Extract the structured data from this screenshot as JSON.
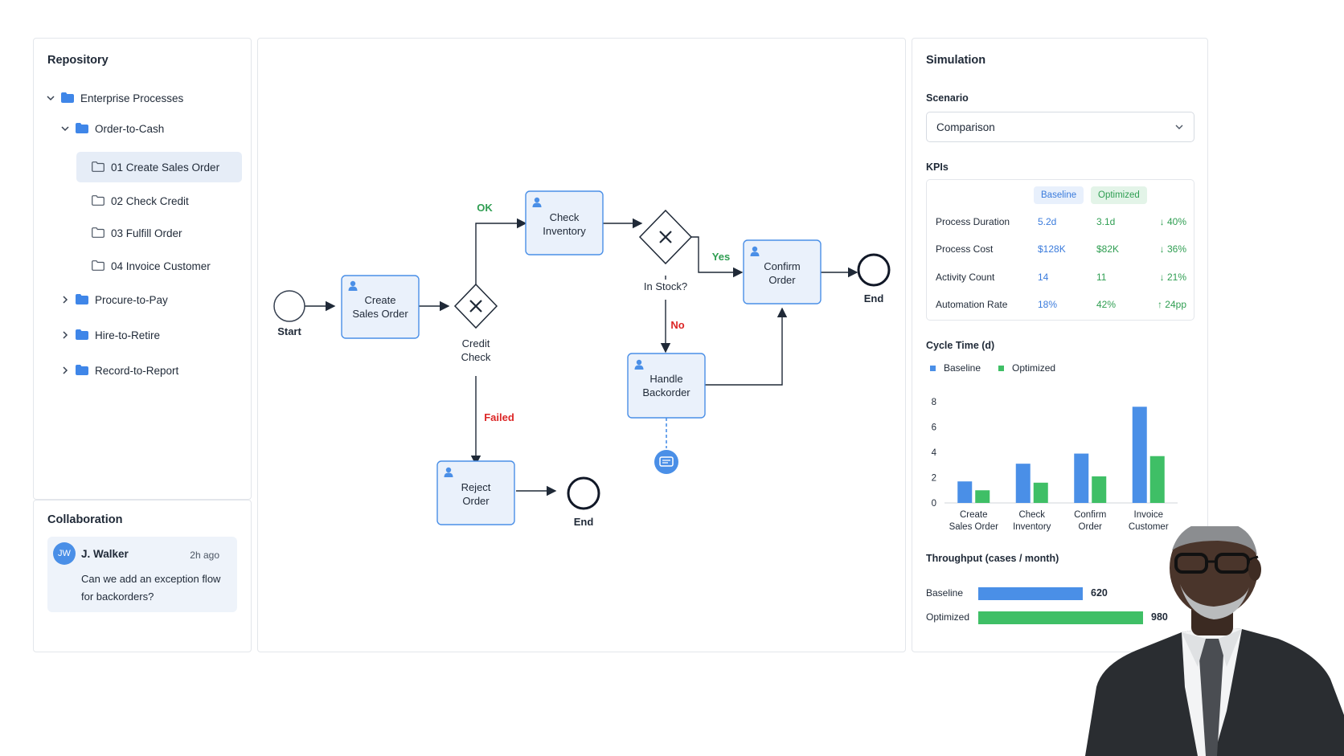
{
  "repository": {
    "title": "Repository",
    "tree": [
      {
        "label": "Enterprise Processes",
        "state": "expanded"
      },
      {
        "label": "Order-to-Cash",
        "state": "expanded"
      },
      {
        "label": "01 Create Sales Order",
        "state": "selected"
      },
      {
        "label": "02 Check Credit"
      },
      {
        "label": "03 Fulfill Order"
      },
      {
        "label": "04 Invoice Customer"
      },
      {
        "label": "Procure-to-Pay",
        "state": "collapsed"
      },
      {
        "label": "Hire-to-Retire",
        "state": "collapsed"
      },
      {
        "label": "Record-to-Report",
        "state": "collapsed"
      }
    ]
  },
  "collaboration": {
    "title": "Collaboration",
    "comment": {
      "initials": "JW",
      "author": "J. Walker",
      "time": "2h ago",
      "text": "Can we add an exception flow for backorders?"
    }
  },
  "diagram": {
    "events": {
      "start": "Start",
      "end_main": "End",
      "end_reject": "End"
    },
    "tasks": {
      "create_sales_order": [
        "Create",
        "Sales Order"
      ],
      "check_inventory": [
        "Check",
        "Inventory"
      ],
      "confirm_order": [
        "Confirm",
        "Order"
      ],
      "handle_backorder": [
        "Handle",
        "Backorder"
      ],
      "reject_order": [
        "Reject",
        "Order"
      ]
    },
    "gateways": {
      "credit_check": [
        "Credit",
        "Check"
      ],
      "in_stock": "In Stock?"
    },
    "flows": {
      "ok": "OK",
      "failed": "Failed",
      "yes": "Yes",
      "no": "No"
    },
    "colors": {
      "ok": "#2f9e52",
      "failed": "#dc2626",
      "task_fill": "#eaf1fb",
      "task_border": "#4a8fe7"
    }
  },
  "simulation": {
    "title": "Simulation",
    "scenario_label": "Scenario",
    "scenario_value": "Comparison",
    "kpis_label": "KPIs",
    "kpi_headers": {
      "baseline": "Baseline",
      "optimized": "Optimized"
    },
    "kpis": [
      {
        "name": "Process Duration",
        "baseline": "5.2d",
        "optimized": "3.1d",
        "delta": "↓ 40%"
      },
      {
        "name": "Process Cost",
        "baseline": "$128K",
        "optimized": "$82K",
        "delta": "↓ 36%"
      },
      {
        "name": "Activity Count",
        "baseline": "14",
        "optimized": "11",
        "delta": "↓ 21%"
      },
      {
        "name": "Automation Rate",
        "baseline": "18%",
        "optimized": "42%",
        "delta": "↑ 24pp"
      }
    ],
    "cycle_title": "Cycle Time (d)",
    "throughput_title": "Throughput (cases / month)"
  },
  "chart_data": [
    {
      "type": "bar",
      "title": "Cycle Time (d)",
      "categories": [
        [
          "Create",
          "Sales Order"
        ],
        [
          "Check",
          "Inventory"
        ],
        [
          "Confirm",
          "Order"
        ],
        [
          "Invoice",
          "Customer"
        ]
      ],
      "series": [
        {
          "name": "Baseline",
          "values": [
            1.7,
            3.1,
            3.9,
            7.6
          ],
          "color": "#4a8fe7"
        },
        {
          "name": "Optimized",
          "values": [
            1.0,
            1.6,
            2.1,
            3.7
          ],
          "color": "#3fbf66"
        }
      ],
      "ylim": [
        0,
        8
      ],
      "yticks": [
        0,
        2,
        4,
        6,
        8
      ],
      "legend": "top-left"
    },
    {
      "type": "bar",
      "orientation": "horizontal",
      "title": "Throughput (cases / month)",
      "categories": [
        "Baseline",
        "Optimized"
      ],
      "values": [
        620,
        980
      ],
      "value_labels": [
        "620",
        "980"
      ],
      "colors": [
        "#4a8fe7",
        "#3fbf66"
      ]
    }
  ]
}
